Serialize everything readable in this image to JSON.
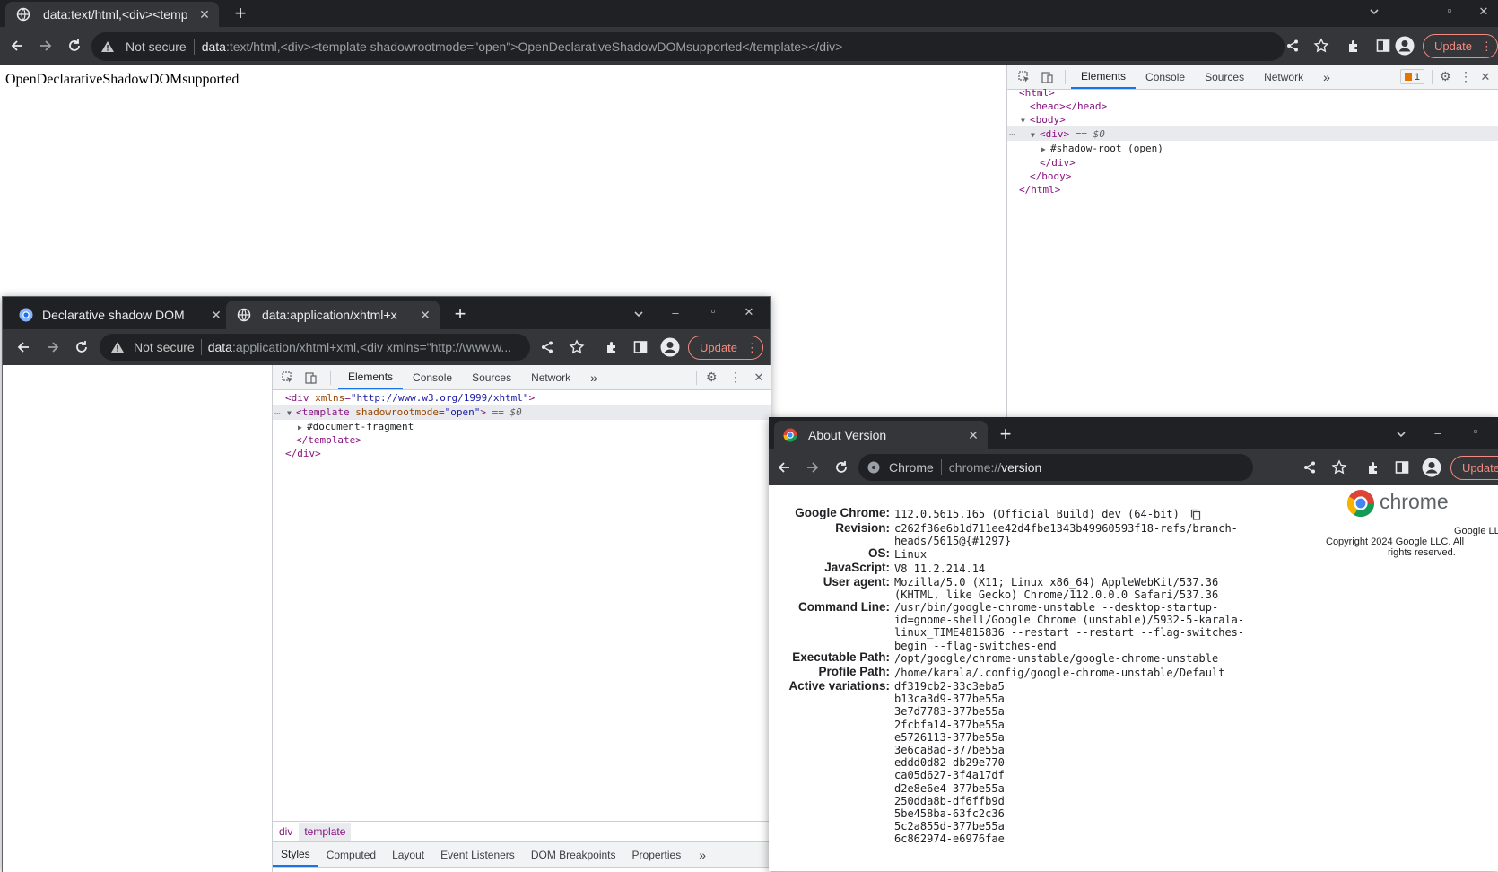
{
  "main_window": {
    "tab": {
      "title": "data:text/html,<div><temp",
      "close": "✕"
    },
    "new_tab": "+",
    "security": "Not secure",
    "url_scheme": "data",
    "url_rest": ":text/html,<div><template shadowrootmode=\"open\">OpenDeclarativeShadowDOMsupported</template></div>",
    "update_label": "Update",
    "page_text": "OpenDeclarativeShadowDOMsupported",
    "devtools": {
      "tabs": [
        "Elements",
        "Console",
        "Sources",
        "Network"
      ],
      "more": "»",
      "issues": "1",
      "dom": {
        "html_open": "<html>",
        "head": "<head></head>",
        "body_open": "<body>",
        "div_open": "<div>",
        "selected_marker": "== $0",
        "shadow_root": "#shadow-root (open)",
        "div_close": "</div>",
        "body_close": "</body>",
        "html_close": "</html>"
      }
    }
  },
  "second_window": {
    "tab1": {
      "title": "Declarative shadow DOM",
      "close": "✕"
    },
    "tab2": {
      "title": "data:application/xhtml+x",
      "close": "✕"
    },
    "new_tab": "+",
    "security": "Not secure",
    "url_scheme": "data",
    "url_rest": ":application/xhtml+xml,<div xmlns=\"http://www.w...",
    "update_label": "Update",
    "devtools": {
      "tabs": [
        "Elements",
        "Console",
        "Sources",
        "Network"
      ],
      "more": "»",
      "dom": {
        "div_tag": "<div",
        "xmlns_attr": "xmlns",
        "xmlns_val": "\"http://www.w3.org/1999/xhtml\"",
        "template_tag": "<template",
        "sr_attr": "shadowrootmode",
        "sr_val": "\"open\"",
        "selected_marker": "== $0",
        "fragment": "#document-fragment",
        "template_close": "</template>",
        "div_close": "</div>"
      },
      "breadcrumbs": [
        "div",
        "template"
      ],
      "bottom_tabs": [
        "Styles",
        "Computed",
        "Layout",
        "Event Listeners",
        "DOM Breakpoints",
        "Properties"
      ]
    }
  },
  "about_window": {
    "tab": {
      "title": "About Version",
      "close": "✕"
    },
    "new_tab": "+",
    "chip": "Chrome",
    "url_scheme": "chrome://",
    "url_rest": "version",
    "update_label": "Update",
    "logo_text": "chrome",
    "company": "Google LLC",
    "copyright": "Copyright 2024 Google LLC. All",
    "rights": "rights reserved.",
    "rows": {
      "chrome_label": "Google Chrome:",
      "chrome_val": "112.0.5615.165 (Official Build) dev (64-bit)",
      "revision_label": "Revision:",
      "revision_val": "c262f36e6b1d711ee42d4fbe1343b49960593f18-refs/branch-\nheads/5615@{#1297}",
      "os_label": "OS:",
      "os_val": "Linux",
      "js_label": "JavaScript:",
      "js_val": "V8 11.2.214.14",
      "ua_label": "User agent:",
      "ua_val": "Mozilla/5.0 (X11; Linux x86_64) AppleWebKit/537.36\n(KHTML, like Gecko) Chrome/112.0.0.0 Safari/537.36",
      "cmd_label": "Command Line:",
      "cmd_val": "/usr/bin/google-chrome-unstable --desktop-startup-\nid=gnome-shell/Google Chrome (unstable)/5932-5-karala-\nlinux_TIME4815836 --restart --restart --flag-switches-\nbegin --flag-switches-end",
      "exe_label": "Executable Path:",
      "exe_val": "/opt/google/chrome-unstable/google-chrome-unstable",
      "profile_label": "Profile Path:",
      "profile_val": "/home/karala/.config/google-chrome-unstable/Default",
      "variations_label": "Active variations:",
      "variations_val": "df319cb2-33c3eba5\nb13ca3d9-377be55a\n3e7d7783-377be55a\n2fcbfa14-377be55a\ne5726113-377be55a\n3e6ca8ad-377be55a\neddd0d82-db29e770\nca05d627-3f4a17df\nd2e8e6e4-377be55a\n250dda8b-df6ffb9d\n5be458ba-63fc2c36\n5c2a855d-377be55a\n6c862974-e6976fae"
    }
  },
  "colors": {
    "tabstrip": "#202124",
    "toolbar": "#35363a",
    "update_accent": "#f28b82",
    "devtools_active": "#1a73e8"
  }
}
